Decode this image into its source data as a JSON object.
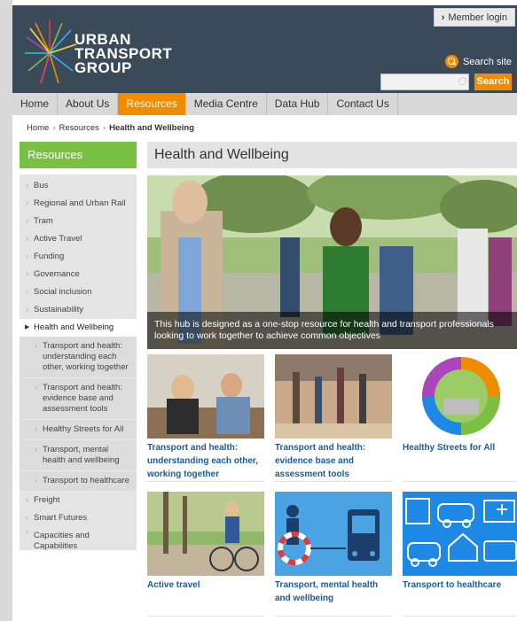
{
  "header": {
    "member_login": "Member login",
    "logo_lines": [
      "URBAN",
      "TRANSPORT",
      "GROUP"
    ],
    "search_label": "Search site",
    "search_placeholder": "",
    "search_button": "Search"
  },
  "nav": {
    "items": [
      "Home",
      "About Us",
      "Resources",
      "Media Centre",
      "Data Hub",
      "Contact Us"
    ],
    "active": "Resources"
  },
  "breadcrumb": {
    "items": [
      "Home",
      "Resources"
    ],
    "current": "Health and Wellbeing"
  },
  "sidebar": {
    "heading": "Resources",
    "items_before": [
      "Bus",
      "Regional and Urban Rail",
      "Tram",
      "Active Travel",
      "Funding",
      "Governance",
      "Social inclusion",
      "Sustainability"
    ],
    "active": "Health and Wellbeing",
    "sub_items": [
      "Transport and health: understanding each other, working together",
      "Transport and health: evidence base and assessment tools",
      "Healthy Streets for All",
      "Transport, mental health and wellbeing",
      "Transport to healthcare"
    ],
    "items_after": [
      "Freight",
      "Smart Futures",
      "Capacities and Capabilities"
    ]
  },
  "main": {
    "title": "Health and Wellbeing",
    "hero_caption": "This hub is designed as a one-stop resource for health and transport professionals looking to work together to achieve common objectives",
    "tiles": [
      "Transport and health: understanding each other, working together",
      "Transport and health: evidence base and assessment tools",
      "Healthy Streets for All",
      "Active travel",
      "Transport, mental health and wellbeing",
      "Transport to healthcare"
    ]
  },
  "colors": {
    "header_bg": "#3b4a59",
    "accent_orange": "#f08c00",
    "sidebar_green": "#7ac143",
    "link_blue": "#1b5b96"
  }
}
